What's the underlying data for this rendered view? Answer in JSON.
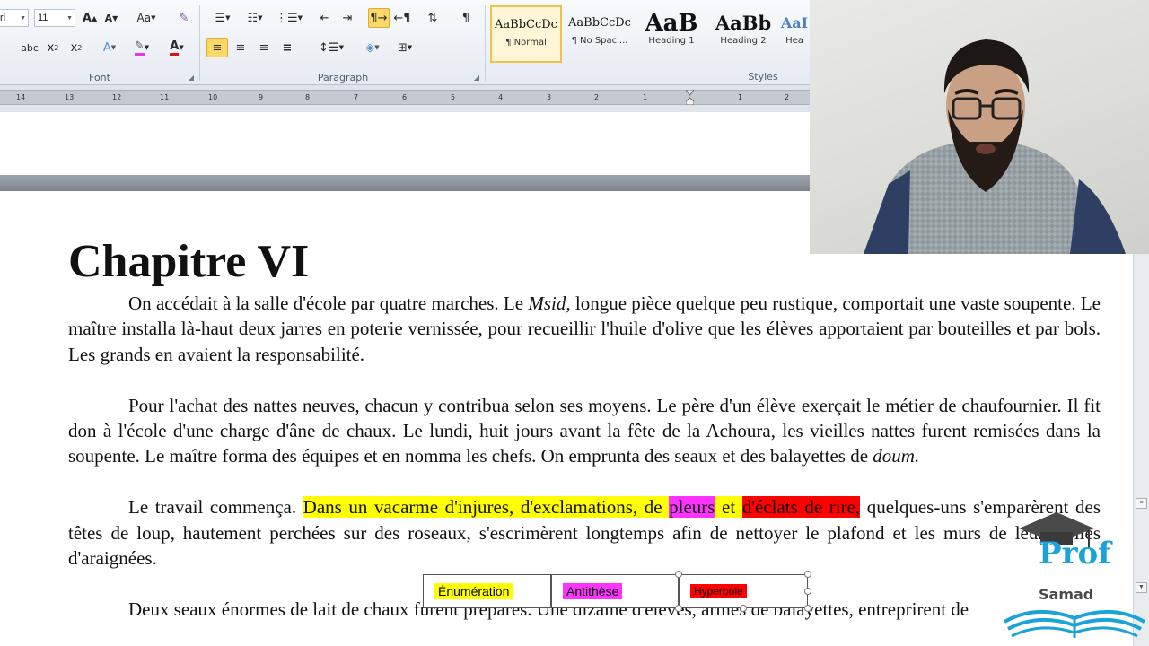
{
  "ribbon": {
    "font_name": "ri",
    "font_size": "11",
    "font_group_label": "Font",
    "paragraph_group_label": "Paragraph",
    "styles_group_label": "Styles",
    "styles": [
      {
        "sample": "AaBbCcDc",
        "name": "¶ Normal"
      },
      {
        "sample": "AaBbCcDc",
        "name": "¶ No Spaci..."
      },
      {
        "sample": "AaB",
        "name": "Heading 1"
      },
      {
        "sample": "AaBb",
        "name": "Heading 2"
      },
      {
        "sample": "AaI",
        "name": "Hea"
      }
    ]
  },
  "ruler": {
    "numbers": [
      "14",
      "13",
      "12",
      "11",
      "10",
      "9",
      "8",
      "7",
      "6",
      "5",
      "4",
      "3",
      "2",
      "1",
      "1",
      "2"
    ]
  },
  "document": {
    "title": "Chapitre VI",
    "p1_a": "On accédait à la salle d'école par quatre marches. Le ",
    "p1_italic": "Msid,",
    "p1_b": " longue pièce quelque peu rustique, comportait une vaste soupente. Le maître installa là-haut deux jarres en poterie vernissée, pour recueillir l'huile d'olive que les élèves apportaient par bouteilles et par bols. Les grands en avaient la responsabilité.",
    "p2_a": "Pour l'achat des nattes neuves, chacun y contribua selon ses moyens. Le père d'un élève exerçait le métier de chaufournier. Il fit don à l'école d'une charge d'âne de chaux. Le lundi, huit jours avant la fête de la Achoura, les vieilles nattes furent remisées dans la soupente. Le maître forma des équipes et en nomma les chefs. On emprunta des seaux et des balayettes de ",
    "p2_italic": "doum.",
    "p3_a": "Le travail commença. ",
    "p3_hl_yellow": "Dans un vacarme d'injures, d'exclamations, de ",
    "p3_hl_magenta": "pleurs",
    "p3_hl_yellow2": " et ",
    "p3_hl_red": "d'éclats de rire,",
    "p3_b": " quelques-uns s'emparèrent des têtes de loup, hautement perchées sur des roseaux, s'escrimèrent longtemps afin de nettoyer le plafond et les murs de leurs toiles d'araignées.",
    "p4": "Deux seaux énormes de lait de chaux furent préparés. Une dizaine d'élèves, armés de balayettes, entreprirent de"
  },
  "annotations": {
    "enumeration": "Énumération",
    "antithese": "Antithèse",
    "hyperbole": "Hyperbole"
  },
  "logo": {
    "line1": "Prof",
    "line2": "Samad"
  },
  "colors": {
    "highlight_yellow": "#ffff00",
    "highlight_magenta": "#ff33ff",
    "highlight_red": "#ff0000",
    "logo_blue": "#1aa3d8"
  }
}
